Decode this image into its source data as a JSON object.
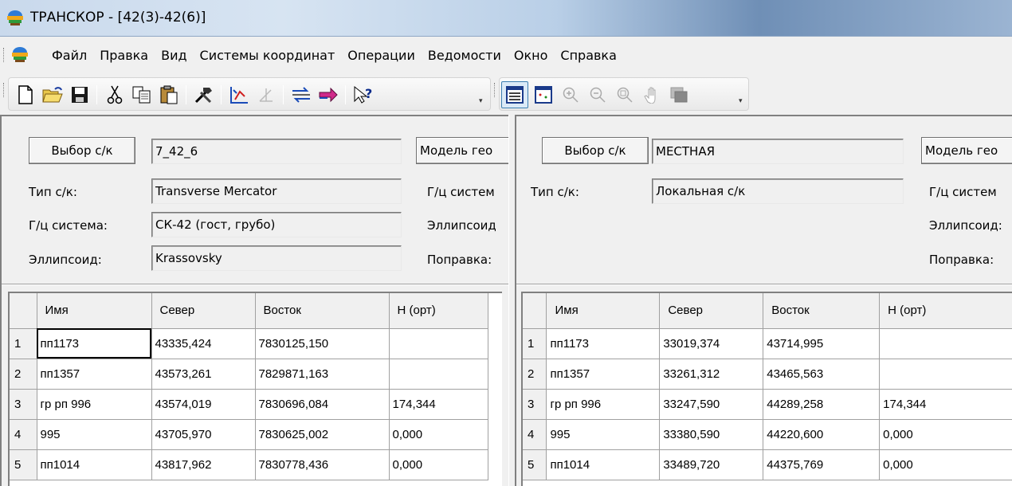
{
  "window": {
    "title": "ТРАНСКОР - [42(3)-42(6)]"
  },
  "menu": {
    "items": [
      "Файл",
      "Правка",
      "Вид",
      "Системы координат",
      "Операции",
      "Ведомости",
      "Окно",
      "Справка"
    ]
  },
  "toolbar": {
    "icons": [
      "new-file-icon",
      "open-folder-icon",
      "save-icon",
      "cut-icon",
      "copy-icon",
      "paste-icon",
      "tools-icon",
      "transform-points-icon",
      "axes-icon",
      "swap-icon",
      "convert-arrow-icon",
      "help-pointer-icon",
      "list-view-icon",
      "map-view-icon",
      "zoom-in-icon",
      "zoom-out-icon",
      "zoom-fit-icon",
      "pan-hand-icon",
      "layers-icon"
    ]
  },
  "left_panel": {
    "select_button": "Выбор с/к",
    "cs_name": "7_42_6",
    "model_label": "Модель гео",
    "type_label": "Тип с/к:",
    "type_value": "Transverse Mercator",
    "geo_system_label": "Г/ц систем",
    "geo_label": "Г/ц система:",
    "geo_value": "СК-42 (гост, грубо)",
    "ellipsoid_right_label": "Эллипсоид",
    "ellipsoid_label": "Эллипсоид:",
    "ellipsoid_value": "Krassovsky",
    "correction_label": "Поправка:",
    "table": {
      "columns": [
        "Имя",
        "Север",
        "Восток",
        "H (орт)"
      ],
      "rows": [
        {
          "n": "1",
          "name": "пп1173",
          "north": "43335,424",
          "east": "7830125,150",
          "h": ""
        },
        {
          "n": "2",
          "name": "пп1357",
          "north": "43573,261",
          "east": "7829871,163",
          "h": ""
        },
        {
          "n": "3",
          "name": "гр рп 996",
          "north": "43574,019",
          "east": "7830696,084",
          "h": "174,344"
        },
        {
          "n": "4",
          "name": "995",
          "north": "43705,970",
          "east": "7830625,002",
          "h": "0,000"
        },
        {
          "n": "5",
          "name": "пп1014",
          "north": "43817,962",
          "east": "7830778,436",
          "h": "0,000"
        }
      ]
    }
  },
  "right_panel": {
    "select_button": "Выбор с/к",
    "cs_name": "МЕСТНАЯ",
    "model_label": "Модель гео",
    "type_label": "Тип с/к:",
    "type_value": "Локальная с/к",
    "geo_system_label": "Г/ц систем",
    "ellipsoid_right_label": "Эллипсоид:",
    "correction_label": "Поправка:",
    "table": {
      "columns": [
        "Имя",
        "Север",
        "Восток",
        "H (орт)"
      ],
      "rows": [
        {
          "n": "1",
          "name": "пп1173",
          "north": "33019,374",
          "east": "43714,995",
          "h": ""
        },
        {
          "n": "2",
          "name": "пп1357",
          "north": "33261,312",
          "east": "43465,563",
          "h": ""
        },
        {
          "n": "3",
          "name": "гр рп 996",
          "north": "33247,590",
          "east": "44289,258",
          "h": "174,344"
        },
        {
          "n": "4",
          "name": "995",
          "north": "33380,590",
          "east": "44220,600",
          "h": "0,000"
        },
        {
          "n": "5",
          "name": "пп1014",
          "north": "33489,720",
          "east": "44375,769",
          "h": "0,000"
        }
      ]
    }
  }
}
